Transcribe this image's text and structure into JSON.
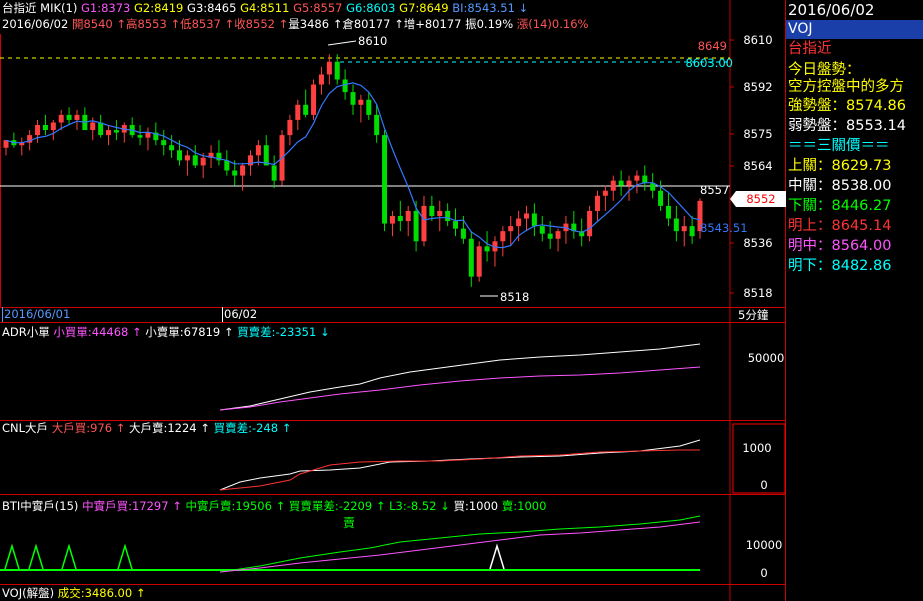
{
  "header": {
    "line1": [
      {
        "text": "台指近 MIK(1) ",
        "color": "#ffffff"
      },
      {
        "text": "G1:8373 ",
        "color": "#ff55ff"
      },
      {
        "text": "G2:8419 ",
        "color": "#ffff00"
      },
      {
        "text": "G3:8465 ",
        "color": "#ffffff"
      },
      {
        "text": "G4:8511 ",
        "color": "#ffff00"
      },
      {
        "text": "G5:8557 ",
        "color": "#ff5555"
      },
      {
        "text": "G6:8603 ",
        "color": "#00ffff"
      },
      {
        "text": "G7:8649 ",
        "color": "#ffff00"
      },
      {
        "text": "BI:8543.51 ↓",
        "color": "#5599ff"
      }
    ],
    "line2": [
      {
        "text": "2016/06/02 ",
        "color": "#ffffff"
      },
      {
        "text": "開8540 ",
        "color": "#ff5555"
      },
      {
        "text": "↑",
        "color": "#ff5555"
      },
      {
        "text": "高8553 ",
        "color": "#ff5555"
      },
      {
        "text": "↑",
        "color": "#ff5555"
      },
      {
        "text": "低8537 ",
        "color": "#ff5555"
      },
      {
        "text": "↑",
        "color": "#ff5555"
      },
      {
        "text": "收8552 ",
        "color": "#ff5555"
      },
      {
        "text": "↑",
        "color": "#ff5555"
      },
      {
        "text": "量3486 ",
        "color": "#ffffff"
      },
      {
        "text": "↑",
        "color": "#ffffff"
      },
      {
        "text": "倉80177 ",
        "color": "#ffffff"
      },
      {
        "text": "↑",
        "color": "#ffffff"
      },
      {
        "text": "增+80177 ",
        "color": "#ffffff"
      },
      {
        "text": "振0.19% ",
        "color": "#ffffff"
      },
      {
        "text": "漲(14)0.16%",
        "color": "#ff5555"
      }
    ]
  },
  "price_axis": {
    "ticks": [
      "8610",
      "8592",
      "8575",
      "8564",
      "8536",
      "8518"
    ],
    "current_price_tag": "8552",
    "ref_label_8649": "8649",
    "ref_label_8603": "8603.00",
    "label_8557": "8557",
    "label_bi": "8543.51",
    "label_high": "8610",
    "label_low": "8518"
  },
  "time_axis": {
    "labels": [
      "2016/06/01",
      "06/02"
    ],
    "interval": "5分鐘"
  },
  "panels": {
    "adr": {
      "segments": [
        {
          "text": "ADR小單 ",
          "color": "#ffffff"
        },
        {
          "text": "小買單:44468 ↑ ",
          "color": "#ff55ff"
        },
        {
          "text": "小賣單:67819 ↑ ",
          "color": "#ffffff"
        },
        {
          "text": "買賣差:-23351 ↓",
          "color": "#00ffff"
        }
      ],
      "ticks": [
        "50000"
      ]
    },
    "cnl": {
      "segments": [
        {
          "text": "CNL大戶 ",
          "color": "#ffffff"
        },
        {
          "text": "大戶買:976 ↑ ",
          "color": "#ff5555"
        },
        {
          "text": "大戶賣:1224 ↑ ",
          "color": "#ffffff"
        },
        {
          "text": "買賣差:-248 ↑",
          "color": "#00ffff"
        }
      ],
      "ticks": [
        "1000",
        "0"
      ]
    },
    "bti": {
      "segments": [
        {
          "text": "BTI中實戶(15) ",
          "color": "#ffffff"
        },
        {
          "text": "中實戶買:17297 ↑ ",
          "color": "#ff55ff"
        },
        {
          "text": "中實戶賣:19506 ↑ ",
          "color": "#00ff00"
        },
        {
          "text": "買賣單差:-2209 ↑ ",
          "color": "#00ff00"
        },
        {
          "text": "L3:-8.52 ↓ ",
          "color": "#00ff00"
        },
        {
          "text": "買:1000 ",
          "color": "#ffffff"
        },
        {
          "text": "賣:1000",
          "color": "#00ff00"
        }
      ],
      "sell_marker": "賣",
      "ticks": [
        "10000",
        "0"
      ]
    },
    "voj": {
      "segments": [
        {
          "text": "VOJ(解盤) ",
          "color": "#ffffff"
        },
        {
          "text": "成交:3486.00 ↑",
          "color": "#ffff00"
        }
      ]
    }
  },
  "sidebar": {
    "date": "2016/06/02",
    "symbol": "VOJ",
    "rows": [
      {
        "text": "台指近",
        "color": "#ff3333"
      },
      {
        "text": "今日盤勢：",
        "color": "#ffff00"
      },
      {
        "text": "空方控盤中的多方",
        "color": "#ffff00"
      },
      {
        "text": "強勢盤：8574.86",
        "color": "#ffff00"
      },
      {
        "text": "弱勢盤：8553.14",
        "color": "#ffffff"
      },
      {
        "text": "＝＝三關價＝＝",
        "color": "#00ffff"
      },
      {
        "text": "上關：8629.73",
        "color": "#ffff00"
      },
      {
        "text": "中關：8538.00",
        "color": "#ffffff"
      },
      {
        "text": "下關：8446.27",
        "color": "#00ff00"
      },
      {
        "text": "明上：8645.14",
        "color": "#ff3333"
      },
      {
        "text": "明中：8564.00",
        "color": "#ff55ff"
      },
      {
        "text": "明下：8482.86",
        "color": "#00ffff"
      }
    ]
  },
  "colors": {
    "up": "#ff4040",
    "down": "#00dd00",
    "ma": "#3377ff",
    "frame": "#cc0000"
  },
  "chart_data": {
    "type": "candlestick",
    "unit": "5分鐘",
    "ylim": [
      8510,
      8618
    ],
    "candles": [
      [
        8573,
        8576,
        8570,
        8576
      ],
      [
        8576,
        8579,
        8573,
        8574
      ],
      [
        8574,
        8577,
        8570,
        8575
      ],
      [
        8575,
        8580,
        8572,
        8578
      ],
      [
        8578,
        8584,
        8575,
        8582
      ],
      [
        8582,
        8586,
        8578,
        8580
      ],
      [
        8580,
        8584,
        8576,
        8583
      ],
      [
        8583,
        8588,
        8580,
        8586
      ],
      [
        8586,
        8589,
        8582,
        8584
      ],
      [
        8584,
        8588,
        8580,
        8586
      ],
      [
        8586,
        8589,
        8582,
        8580
      ],
      [
        8580,
        8585,
        8576,
        8583
      ],
      [
        8583,
        8586,
        8577,
        8578
      ],
      [
        8578,
        8582,
        8574,
        8580
      ],
      [
        8580,
        8584,
        8576,
        8579
      ],
      [
        8579,
        8583,
        8575,
        8582
      ],
      [
        8582,
        8585,
        8577,
        8578
      ],
      [
        8578,
        8582,
        8574,
        8577
      ],
      [
        8577,
        8581,
        8572,
        8579
      ],
      [
        8579,
        8583,
        8574,
        8576
      ],
      [
        8576,
        8580,
        8570,
        8574
      ],
      [
        8574,
        8578,
        8569,
        8572
      ],
      [
        8572,
        8576,
        8566,
        8568
      ],
      [
        8568,
        8572,
        8562,
        8570
      ],
      [
        8570,
        8574,
        8565,
        8566
      ],
      [
        8566,
        8571,
        8561,
        8569
      ],
      [
        8569,
        8574,
        8565,
        8571
      ],
      [
        8571,
        8576,
        8566,
        8568
      ],
      [
        8568,
        8572,
        8562,
        8564
      ],
      [
        8564,
        8568,
        8558,
        8562
      ],
      [
        8562,
        8567,
        8556,
        8566
      ],
      [
        8566,
        8572,
        8562,
        8570
      ],
      [
        8570,
        8576,
        8566,
        8574
      ],
      [
        8574,
        8578,
        8568,
        8566
      ],
      [
        8566,
        8570,
        8557,
        8560
      ],
      [
        8560,
        8580,
        8558,
        8578
      ],
      [
        8578,
        8586,
        8574,
        8584
      ],
      [
        8584,
        8592,
        8580,
        8590
      ],
      [
        8590,
        8596,
        8585,
        8586
      ],
      [
        8586,
        8600,
        8584,
        8598
      ],
      [
        8598,
        8605,
        8594,
        8602
      ],
      [
        8602,
        8610,
        8598,
        8607
      ],
      [
        8607,
        8610,
        8598,
        8600
      ],
      [
        8600,
        8604,
        8592,
        8595
      ],
      [
        8595,
        8598,
        8586,
        8590
      ],
      [
        8590,
        8594,
        8583,
        8592
      ],
      [
        8592,
        8595,
        8584,
        8586
      ],
      [
        8586,
        8590,
        8575,
        8578
      ],
      [
        8578,
        8580,
        8540,
        8543
      ],
      [
        8543,
        8548,
        8538,
        8546
      ],
      [
        8546,
        8552,
        8540,
        8544
      ],
      [
        8544,
        8550,
        8538,
        8548
      ],
      [
        8548,
        8552,
        8532,
        8536
      ],
      [
        8536,
        8554,
        8534,
        8550
      ],
      [
        8550,
        8554,
        8544,
        8546
      ],
      [
        8546,
        8552,
        8540,
        8548
      ],
      [
        8548,
        8551,
        8542,
        8544
      ],
      [
        8544,
        8549,
        8538,
        8541
      ],
      [
        8541,
        8546,
        8535,
        8537
      ],
      [
        8537,
        8540,
        8518,
        8522
      ],
      [
        8522,
        8536,
        8520,
        8534
      ],
      [
        8534,
        8540,
        8528,
        8532
      ],
      [
        8532,
        8538,
        8526,
        8536
      ],
      [
        8536,
        8542,
        8530,
        8540
      ],
      [
        8540,
        8546,
        8534,
        8542
      ],
      [
        8542,
        8548,
        8536,
        8545
      ],
      [
        8545,
        8550,
        8540,
        8547
      ],
      [
        8547,
        8551,
        8538,
        8542
      ],
      [
        8542,
        8546,
        8536,
        8539
      ],
      [
        8539,
        8544,
        8533,
        8537
      ],
      [
        8537,
        8541,
        8532,
        8540
      ],
      [
        8540,
        8546,
        8535,
        8543
      ],
      [
        8543,
        8548,
        8537,
        8540
      ],
      [
        8540,
        8545,
        8534,
        8538
      ],
      [
        8538,
        8550,
        8536,
        8548
      ],
      [
        8548,
        8556,
        8544,
        8554
      ],
      [
        8554,
        8558,
        8548,
        8556
      ],
      [
        8556,
        8562,
        8552,
        8560
      ],
      [
        8560,
        8564,
        8554,
        8558
      ],
      [
        8558,
        8562,
        8552,
        8560
      ],
      [
        8560,
        8564,
        8555,
        8562
      ],
      [
        8562,
        8566,
        8556,
        8559
      ],
      [
        8559,
        8563,
        8553,
        8556
      ],
      [
        8556,
        8560,
        8548,
        8550
      ],
      [
        8550,
        8555,
        8542,
        8545
      ],
      [
        8545,
        8550,
        8536,
        8540
      ],
      [
        8540,
        8546,
        8534,
        8542
      ],
      [
        8542,
        8546,
        8535,
        8538
      ],
      [
        8540,
        8553,
        8537,
        8552
      ]
    ],
    "ma_line": "BI",
    "reference_lines": [
      8649,
      8603,
      8557
    ]
  }
}
